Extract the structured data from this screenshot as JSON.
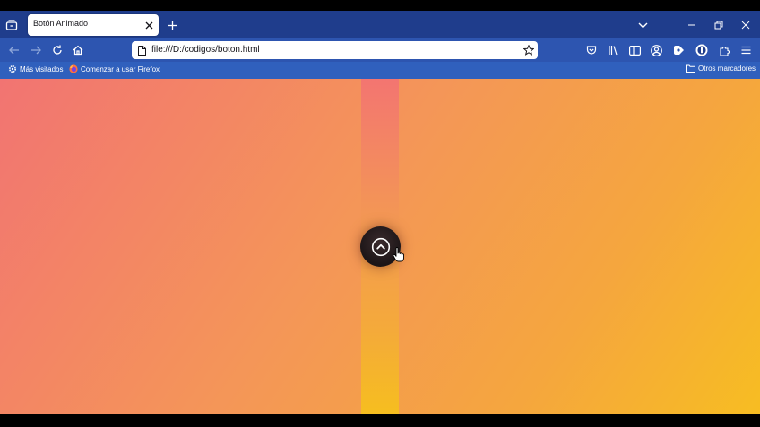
{
  "tab": {
    "title": "Botón Animado"
  },
  "address_bar": {
    "url": "file:///D:/codigos/boton.html"
  },
  "bookmarks": {
    "most_visited": "Más visitados",
    "getting_started": "Comenzar a usar Firefox",
    "other_bookmarks": "Otros marcadores"
  },
  "theme": {
    "tabbar_color": "#1f3d8c",
    "navbar_color": "#2d55b0",
    "bookmarks_bar_color": "#3060bd",
    "gradient_start": "#f27472",
    "gradient_end": "#f7bd22",
    "button_color": "#1c1517"
  },
  "icons": [
    "tab-list-icon",
    "close-icon",
    "plus-icon",
    "chevron-down-icon",
    "minimize-icon",
    "restore-icon",
    "back-icon",
    "forward-icon",
    "reload-icon",
    "home-icon",
    "page-icon",
    "star-icon",
    "pocket-icon",
    "library-icon",
    "sidebar-icon",
    "account-icon",
    "extension-icon",
    "puzzle-icon",
    "menu-icon",
    "gear-icon",
    "firefox-icon",
    "folder-icon",
    "chevron-up-icon",
    "hand-cursor-icon"
  ]
}
